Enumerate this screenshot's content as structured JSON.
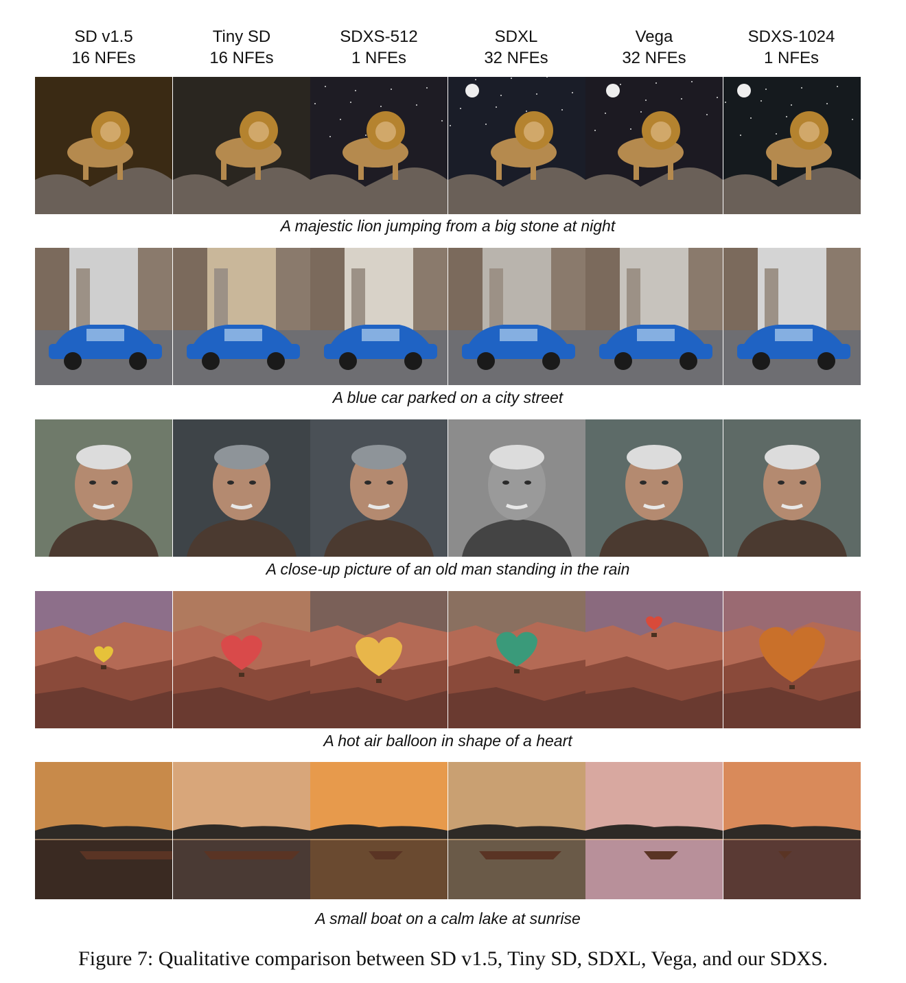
{
  "columns": [
    {
      "name": "SD v1.5",
      "steps": "16 NFEs"
    },
    {
      "name": "Tiny SD",
      "steps": "16 NFEs"
    },
    {
      "name": "SDXS-512",
      "steps": "1 NFEs"
    },
    {
      "name": "SDXL",
      "steps": "32 NFEs"
    },
    {
      "name": "Vega",
      "steps": "32 NFEs"
    },
    {
      "name": "SDXS-1024",
      "steps": "1 NFEs"
    }
  ],
  "rows": [
    {
      "prompt": "A majestic lion jumping from a big stone at night",
      "subject": "lion"
    },
    {
      "prompt": "A blue car parked on a city street",
      "subject": "car"
    },
    {
      "prompt": "A close-up picture of an old man standing in the rain",
      "subject": "old-man"
    },
    {
      "prompt": "A hot air balloon in shape of a heart",
      "subject": "balloon"
    },
    {
      "prompt": "A small boat on a calm lake at sunrise",
      "subject": "boat"
    }
  ],
  "figure_caption": "Figure 7: Qualitative comparison between SD v1.5, Tiny SD, SDXL, Vega, and our SDXS.",
  "colors": {
    "lion_bg": "#1c1a22",
    "lion_mane": "#b5832f",
    "car_blue": "#1f63c4",
    "street": "#6e6e72",
    "skin": "#b48a70",
    "canyon": "#b46a55",
    "sunset": "#e79a4c",
    "water": "#3a2a22"
  }
}
